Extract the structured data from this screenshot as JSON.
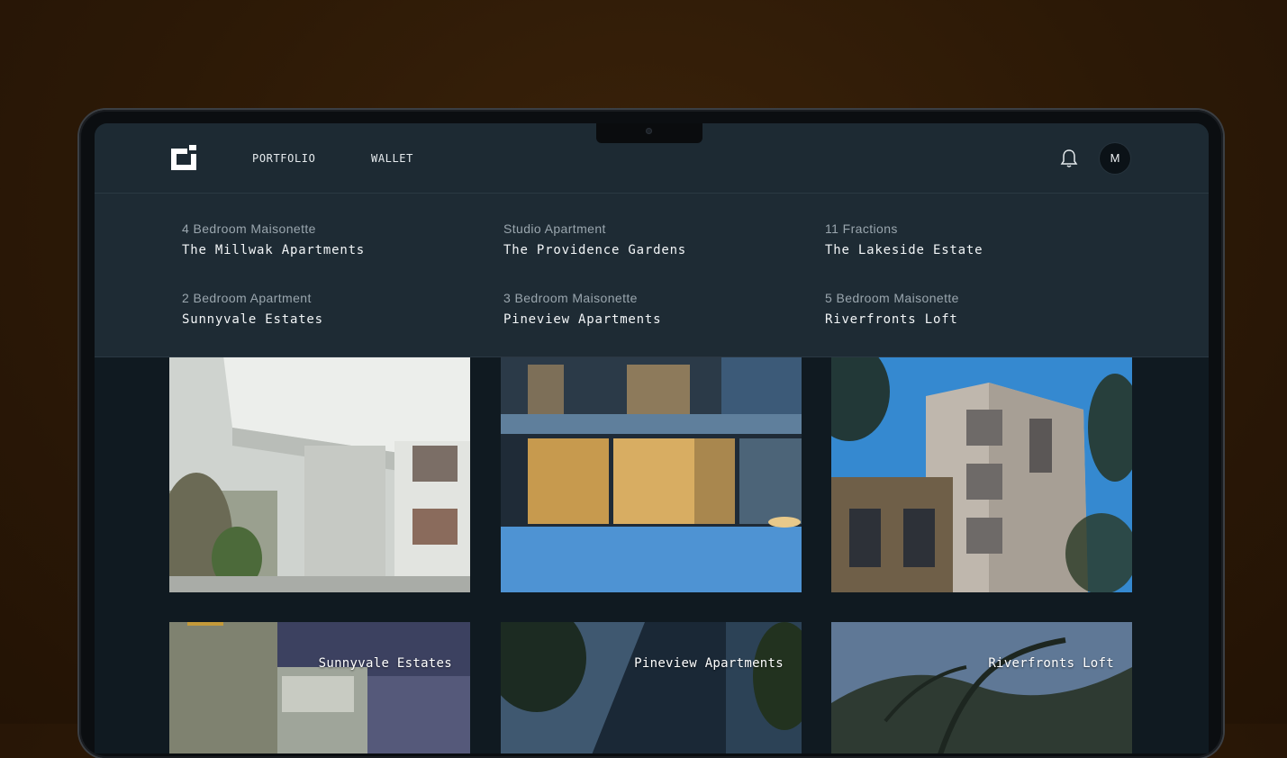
{
  "nav": {
    "links": [
      "PORTFOLIO",
      "WALLET"
    ],
    "avatar_initial": "M"
  },
  "dropdown": {
    "items": [
      {
        "subtitle": "4 Bedroom Maisonette",
        "title": "The Millwak Apartments"
      },
      {
        "subtitle": "Studio Apartment",
        "title": "The Providence Gardens"
      },
      {
        "subtitle": "11 Fractions",
        "title": "The Lakeside Estate"
      },
      {
        "subtitle": "2 Bedroom Apartment",
        "title": "Sunnyvale Estates"
      },
      {
        "subtitle": "3 Bedroom Maisonette",
        "title": "Pineview Apartments"
      },
      {
        "subtitle": "5 Bedroom Maisonette",
        "title": "Riverfronts Loft"
      }
    ]
  },
  "cards": {
    "row2_labels": [
      "Sunnyvale Estates",
      "Pineview Apartments",
      "Riverfronts Loft"
    ]
  },
  "colors": {
    "background": "#2c1906",
    "navbar": "#1d2a33",
    "dropdown": "#1e2b34",
    "screen": "#101a21"
  }
}
